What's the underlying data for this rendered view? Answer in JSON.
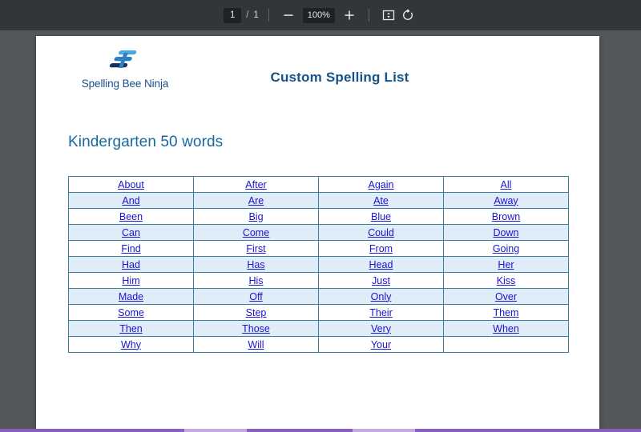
{
  "toolbar": {
    "page_current": "1",
    "page_separator": "/",
    "page_total": "1",
    "zoom_out_label": "−",
    "zoom_value": "100%",
    "zoom_in_label": "+",
    "fit_icon": "fit-to-page-icon",
    "rotate_icon": "rotate-counterclockwise-icon"
  },
  "document": {
    "brand_name": "Spelling Bee Ninja",
    "logo_icon": "spelling-bee-ninja-logo",
    "title": "Custom Spelling List",
    "subtitle": "Kindergarten 50 words",
    "word_rows": [
      [
        "About",
        "After",
        "Again",
        "All"
      ],
      [
        "And",
        "Are",
        "Ate",
        "Away"
      ],
      [
        "Been",
        "Big",
        "Blue",
        "Brown"
      ],
      [
        "Can",
        "Come",
        "Could",
        "Down"
      ],
      [
        "Find",
        "First",
        "From",
        "Going"
      ],
      [
        "Had",
        "Has",
        "Head",
        "Her"
      ],
      [
        "Him",
        "His",
        "Just",
        "Kiss"
      ],
      [
        "Made",
        "Off",
        "Only",
        "Over"
      ],
      [
        "Some",
        "Step",
        "Their",
        "Them"
      ],
      [
        "Then",
        "Those",
        "Very",
        "When"
      ],
      [
        "Why",
        "Will",
        "Your",
        ""
      ]
    ]
  },
  "colors": {
    "toolbar_bg": "#323639",
    "viewer_bg": "#54585c",
    "page_bg": "#ffffff",
    "title_blue": "#14538c",
    "subtitle_blue": "#15699e",
    "link_blue": "#1715d4",
    "table_border": "#3d7e9c",
    "row_alt_bg": "#e1ecf9",
    "bottom_bar": "#8b5fbf"
  }
}
